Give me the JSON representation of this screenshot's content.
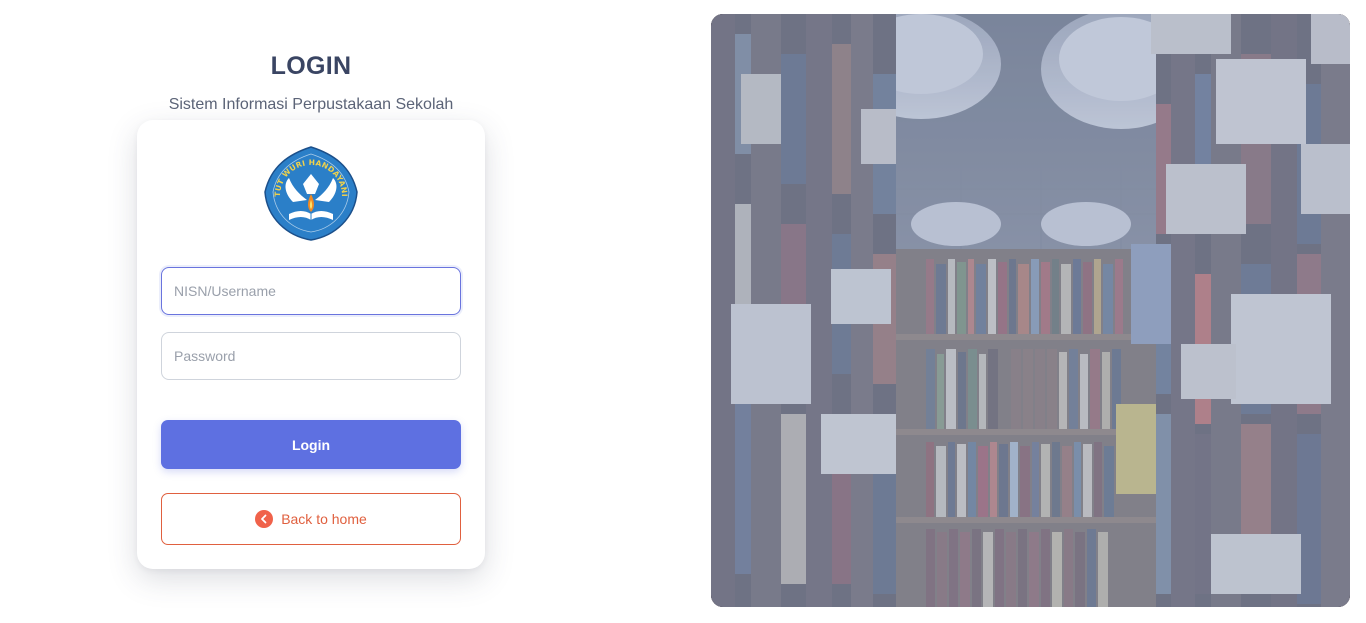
{
  "header": {
    "title": "LOGIN",
    "subtitle": "Sistem Informasi Perpustakaan Sekolah"
  },
  "logo": {
    "icon": "tut-wuri-handayani-emblem",
    "text": "TUT WURI HANDAYANI"
  },
  "form": {
    "username_placeholder": "NISN/Username",
    "password_placeholder": "Password",
    "login_label": "Login",
    "back_label": "Back to home",
    "back_icon": "chevron-left-circle-icon"
  },
  "hero": {
    "image": "library-bookshelves-photo"
  },
  "colors": {
    "primary": "#5e70e1",
    "accent": "#e0603f",
    "title": "#3a4563"
  }
}
